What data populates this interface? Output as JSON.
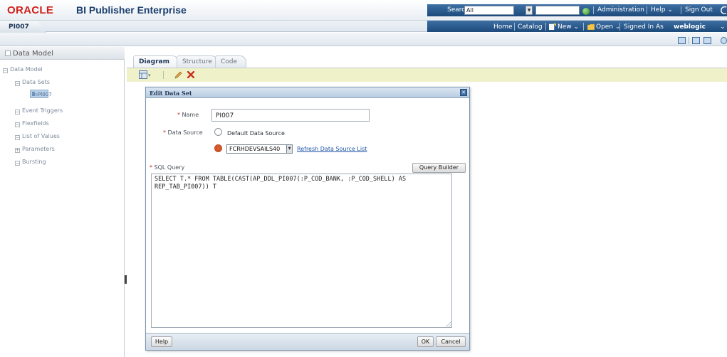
{
  "header": {
    "brand_oracle": "ORACLE",
    "brand_product": "BI Publisher Enterprise",
    "search_label": "Search",
    "search_scope": "All",
    "search_value": "",
    "links": {
      "administration": "Administration",
      "help": "Help ⌄",
      "sign_out": "Sign Out"
    }
  },
  "nav": {
    "tab_title": "PI007",
    "home": "Home",
    "catalog": "Catalog",
    "new": "New ⌄",
    "open": "Open ⌄",
    "signed_in_as": "Signed In As",
    "user": "weblogic",
    "user_chevron": "⌄"
  },
  "left_panel": {
    "title": "Data Model",
    "items": [
      {
        "label": "Data Model",
        "icon": "collapse-icon"
      },
      {
        "label": "Data Sets",
        "icon": "collapse-icon"
      },
      {
        "label": "PI007",
        "icon": "dataset-icon",
        "selected": true
      },
      {
        "label": "Event Triggers",
        "icon": "collapse-icon"
      },
      {
        "label": "Flexfields",
        "icon": "collapse-icon"
      },
      {
        "label": "List of Values",
        "icon": "collapse-icon"
      },
      {
        "label": "Parameters",
        "icon": "expand-icon"
      },
      {
        "label": "Bursting",
        "icon": "collapse-icon"
      }
    ]
  },
  "tabs": [
    {
      "label": "Diagram",
      "active": true
    },
    {
      "label": "Structure",
      "active": false
    },
    {
      "label": "Code",
      "active": false
    }
  ],
  "dialog": {
    "title": "Edit Data Set",
    "name_label": "Name",
    "name_value": "PI007",
    "data_source_label": "Data Source",
    "option_default": "Default Data Source",
    "option_selected_source": "FCRHDEVSAILS40",
    "refresh_link": "Refresh Data Source List",
    "sql_label": "SQL Query",
    "query_builder": "Query Builder",
    "sql_text": "SELECT T.* FROM TABLE(CAST(AP_DDL_PI007(:P_COD_BANK, :P_COD_SHELL) AS REP_TAB_PI007)) T",
    "help": "Help",
    "ok": "OK",
    "cancel": "Cancel",
    "selected_option": "data-source-list"
  },
  "colors": {
    "oracle_red": "#d0211a",
    "header_blue": "#1d4a7b",
    "link_blue": "#1f55a6",
    "toolbar_yellow": "#eff2c8"
  }
}
